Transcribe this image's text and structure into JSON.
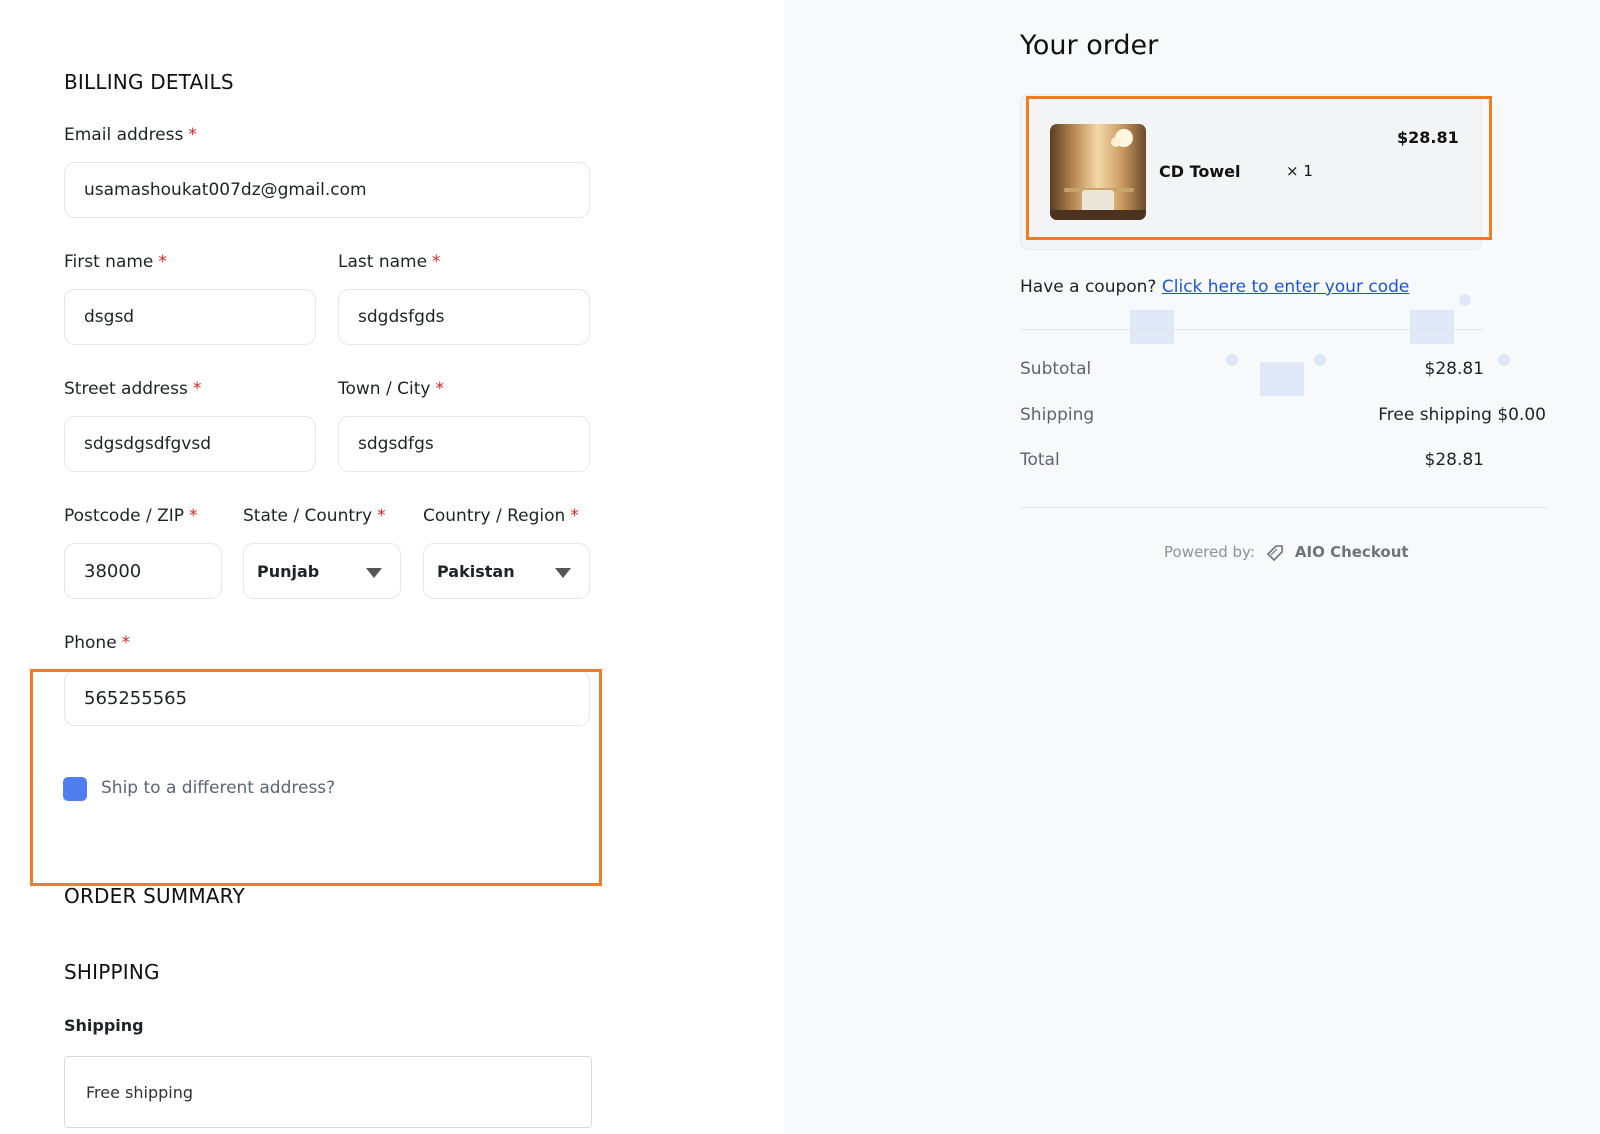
{
  "billing": {
    "title": "BILLING DETAILS",
    "email": {
      "label": "Email address",
      "value": "usamashoukat007dz@gmail.com"
    },
    "first_name": {
      "label": "First name",
      "value": "dsgsd"
    },
    "last_name": {
      "label": "Last name",
      "value": "sdgdsfgds"
    },
    "street": {
      "label": "Street address",
      "value": "sdgsdgsdfgvsd"
    },
    "city": {
      "label": "Town / City",
      "value": "sdgsdfgs"
    },
    "postcode": {
      "label": "Postcode / ZIP",
      "value": "38000"
    },
    "state": {
      "label": "State / Country",
      "value": "Punjab"
    },
    "country": {
      "label": "Country / Region",
      "value": "Pakistan"
    },
    "phone": {
      "label": "Phone",
      "value": "565255565"
    },
    "required_mark": "*",
    "ship_different": "Ship to a different address?"
  },
  "order_summary_title": "ORDER SUMMARY",
  "shipping": {
    "title": "SHIPPING",
    "label": "Shipping",
    "value": "Free shipping"
  },
  "order": {
    "title": "Your order",
    "item": {
      "name": "CD Towel",
      "qty": "× 1",
      "price": "$28.81"
    },
    "coupon_text": "Have a coupon?",
    "coupon_link": "Click here to enter your code",
    "subtotal_label": "Subtotal",
    "subtotal_value": "$28.81",
    "shipping_label": "Shipping",
    "shipping_value": "Free shipping $0.00",
    "total_label": "Total",
    "total_value": "$28.81"
  },
  "footer": {
    "powered_by": "Powered by:",
    "brand": "AIO Checkout"
  },
  "colors": {
    "accent_highlight": "#f47b20",
    "checkbox": "#4f7ef0",
    "link": "#1a56db",
    "required": "#e02424"
  }
}
